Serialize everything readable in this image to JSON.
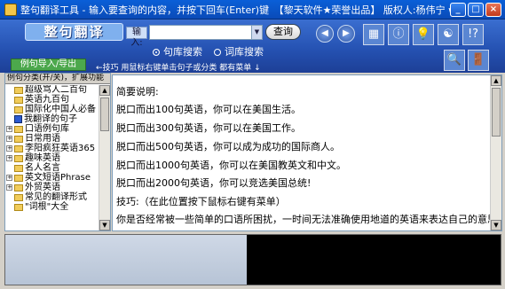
{
  "window": {
    "title": "整句翻译工具 - 输入要查询的内容，并按下回车(Enter)键　【黎天软件★荣誉出品】 版权人:杨伟宁 www.Boobsoft.com",
    "btn_min": "_",
    "btn_max": "□",
    "btn_close": "×"
  },
  "toolbar": {
    "logo": "整句翻译",
    "input_label": "输入:",
    "search_value": "",
    "query_label": "查询",
    "radio_example": "句库搜索",
    "radio_word": "词库搜索",
    "import_label": "例句导入/导出",
    "tip": "←技巧 用鼠标右键单击句子或分类 都有菜单 ↓",
    "back_glyph": "◀",
    "forward_glyph": "▶",
    "icon_glyphs": [
      "▦",
      "ⓘ",
      "💡",
      "☯",
      "!?",
      "🔍",
      "🚪"
    ]
  },
  "left_panel": {
    "header": "例句分类(开/关)，扩展功能",
    "items": [
      {
        "label": "超级骂人二百句",
        "expandable": false,
        "icon": "folder"
      },
      {
        "label": "英语九百句",
        "expandable": false,
        "icon": "folder"
      },
      {
        "label": "国际化中国人必备",
        "expandable": false,
        "icon": "folder"
      },
      {
        "label": "我翻译的句子",
        "expandable": false,
        "icon": "book"
      },
      {
        "label": "口语例句库",
        "expandable": true,
        "icon": "folder"
      },
      {
        "label": "日常用语",
        "expandable": true,
        "icon": "folder"
      },
      {
        "label": "李阳疯狂英语365",
        "expandable": true,
        "icon": "folder"
      },
      {
        "label": "趣味英语",
        "expandable": true,
        "icon": "folder"
      },
      {
        "label": "名人名言",
        "expandable": false,
        "icon": "folder"
      },
      {
        "label": "英文短语Phrase",
        "expandable": true,
        "icon": "folder"
      },
      {
        "label": "外贸英语",
        "expandable": true,
        "icon": "folder"
      },
      {
        "label": "常见的翻译形式",
        "expandable": false,
        "icon": "folder"
      },
      {
        "label": "\"词根\"大全",
        "expandable": false,
        "icon": "folder"
      }
    ],
    "expand_glyph": "+"
  },
  "right_panel": {
    "lines": [
      "简要说明:",
      "脱口而出100句英语，你可以在美国生活。",
      "脱口而出300句英语，你可以在美国工作。",
      "脱口而出500句英语，你可以成为成功的国际商人。",
      "脱口而出1000句英语，你可以在美国教英文和中文。",
      "脱口而出2000句英语，你可以竞选美国总统!",
      "技巧:（在此位置按下鼠标右键有菜单）",
      "你是否经常被一些简单的口语所困扰，一时间无法准确使用地道的英语来表达自己的意思?"
    ]
  },
  "scroll": {
    "up": "▲",
    "down": "▼"
  }
}
